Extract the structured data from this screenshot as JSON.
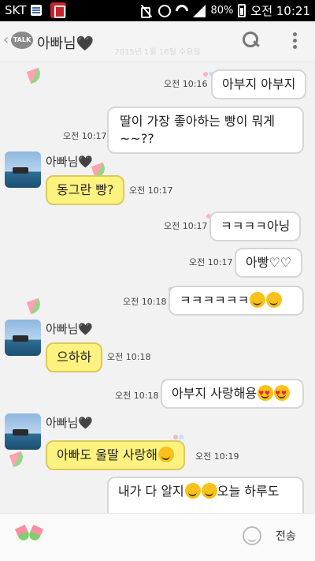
{
  "status_bar": {
    "carrier": "SKT",
    "battery": "80%",
    "time": "오전 10:21"
  },
  "header": {
    "back_icon": "chevron-left-icon",
    "badge": "TALK",
    "title": "아빠님🖤",
    "faint_date": "2015년 1월 16일 수요일"
  },
  "messages": [
    {
      "from": "me",
      "text": "아부지 아부지",
      "time": "오전 10:16"
    },
    {
      "from": "me",
      "text": "딸이 가장 좋아하는 빵이 뭐게~~??",
      "time": "오전 10:17"
    },
    {
      "from": "them",
      "sender": "아빠님",
      "text": "동그란 빵?",
      "time": "오전 10:17"
    },
    {
      "from": "me",
      "text": "ㅋㅋㅋㅋ아닝",
      "time": "오전 10:17"
    },
    {
      "from": "me",
      "text": "아빵♡♡",
      "time": "오전 10:17"
    },
    {
      "from": "me",
      "text": "ㅋㅋㅋㅋㅋㅋ",
      "time": "오전 10:18",
      "emoji": "grin"
    },
    {
      "from": "them",
      "sender": "아빠님",
      "text": "으하하",
      "time": "오전 10:18"
    },
    {
      "from": "me",
      "text": "아부지 사랑해용",
      "time": "오전 10:18",
      "emoji": "heart-eyes"
    },
    {
      "from": "them",
      "sender": "아빠님",
      "text": "아빠도 울딸 사랑해",
      "time": "오전 10:19",
      "emoji": "smile"
    },
    {
      "from": "me",
      "text": "내가 다 알지",
      "text2": "오늘 하루도",
      "emoji": "wink"
    }
  ],
  "input": {
    "placeholder": "",
    "send_label": "전송"
  },
  "colors": {
    "my_bubble": "#ffffff",
    "their_bubble": "#fdf27f",
    "background": "#f2f2f2"
  }
}
